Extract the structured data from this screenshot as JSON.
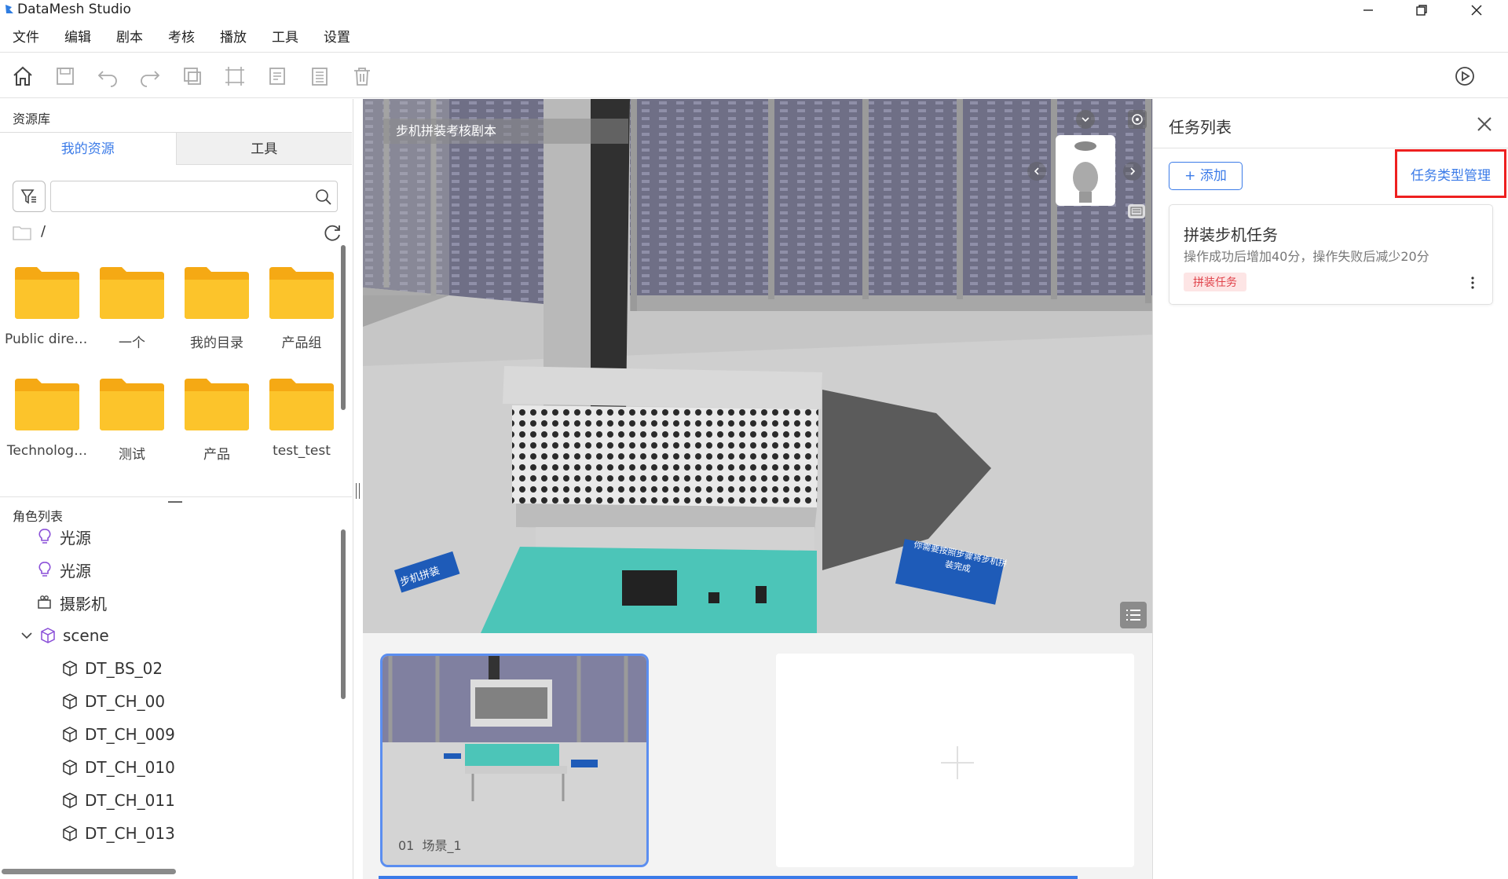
{
  "window": {
    "title": "DataMesh Studio"
  },
  "menu": {
    "items": [
      "文件",
      "编辑",
      "剧本",
      "考核",
      "播放",
      "工具",
      "设置"
    ]
  },
  "toolbar": {
    "icons": [
      "home-icon",
      "save-icon",
      "undo-icon",
      "redo-icon",
      "copy-icon",
      "layout-icon",
      "note-icon",
      "list-icon",
      "delete-icon",
      "play-icon"
    ]
  },
  "resources": {
    "title": "资源库",
    "tabs": [
      "我的资源",
      "工具"
    ],
    "active_tab": "我的资源",
    "search_placeholder": "",
    "path": "/",
    "folders": [
      "Public direc…",
      "一个",
      "我的目录",
      "产品组",
      "Technolog…",
      "测试",
      "产品",
      "test_test"
    ]
  },
  "roles": {
    "title": "角色列表",
    "items": [
      {
        "label": "光源",
        "icon": "bulb-icon",
        "indent": 1
      },
      {
        "label": "光源",
        "icon": "bulb-icon",
        "indent": 1
      },
      {
        "label": "摄影机",
        "icon": "camera-icon",
        "indent": 1
      },
      {
        "label": "scene",
        "icon": "cube-icon",
        "indent": 0,
        "expanded": true
      },
      {
        "label": "DT_BS_02",
        "icon": "cube-icon",
        "indent": 2
      },
      {
        "label": "DT_CH_00",
        "icon": "cube-icon",
        "indent": 2
      },
      {
        "label": "DT_CH_009",
        "icon": "cube-icon",
        "indent": 2
      },
      {
        "label": "DT_CH_010",
        "icon": "cube-icon",
        "indent": 2
      },
      {
        "label": "DT_CH_011",
        "icon": "cube-icon",
        "indent": 2
      },
      {
        "label": "DT_CH_013",
        "icon": "cube-icon",
        "indent": 2
      }
    ]
  },
  "viewport": {
    "scene_title": "步机拼装考核剧本",
    "sign_left": "步机拼装",
    "sign_right": "你需要按照步骤将步机拼装完成"
  },
  "slides": {
    "items": [
      {
        "number": "01",
        "name": "场景_1"
      }
    ]
  },
  "tasks": {
    "title": "任务列表",
    "add_label": "+ 添加",
    "type_manage_label": "任务类型管理",
    "items": [
      {
        "name": "拼装步机任务",
        "desc": "操作成功后增加40分，操作失败后减少20分",
        "tag": "拼装任务"
      }
    ]
  },
  "colors": {
    "accent": "#3b7be8",
    "highlight_box": "#ee2020",
    "tag_bg": "#fde5e5",
    "tag_text": "#e0424a",
    "folder": "#f7b91b"
  }
}
